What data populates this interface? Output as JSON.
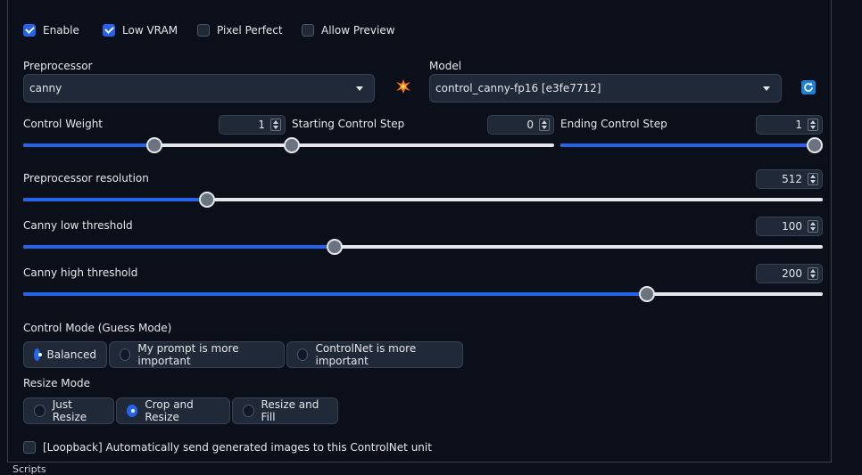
{
  "checkboxes": [
    {
      "label": "Enable",
      "checked": true
    },
    {
      "label": "Low VRAM",
      "checked": true
    },
    {
      "label": "Pixel Perfect",
      "checked": false
    },
    {
      "label": "Allow Preview",
      "checked": false
    }
  ],
  "preprocessor": {
    "label": "Preprocessor",
    "value": "canny"
  },
  "model": {
    "label": "Model",
    "value": "control_canny-fp16 [e3fe7712]"
  },
  "control_weight": {
    "label": "Control Weight",
    "value": "1",
    "fraction": 0.5
  },
  "starting_step": {
    "label": "Starting Control Step",
    "value": "0",
    "fraction": 0.0
  },
  "ending_step": {
    "label": "Ending Control Step",
    "value": "1",
    "fraction": 1.0
  },
  "resolution": {
    "label": "Preprocessor resolution",
    "value": "512",
    "fraction": 0.23
  },
  "canny_low": {
    "label": "Canny low threshold",
    "value": "100",
    "fraction": 0.39
  },
  "canny_high": {
    "label": "Canny high threshold",
    "value": "200",
    "fraction": 0.78
  },
  "control_mode": {
    "label": "Control Mode (Guess Mode)",
    "options": [
      "Balanced",
      "My prompt is more important",
      "ControlNet is more important"
    ],
    "selected": 0
  },
  "resize_mode": {
    "label": "Resize Mode",
    "options": [
      "Just Resize",
      "Crop and Resize",
      "Resize and Fill"
    ],
    "selected": 1
  },
  "loopback": {
    "label": "[Loopback] Automatically send generated images to this ControlNet unit",
    "checked": false
  },
  "footer_text": "Scripts",
  "colors": {
    "accent": "#2563eb",
    "background": "#0b0f19",
    "input": "#1f2937",
    "border": "#374151"
  }
}
